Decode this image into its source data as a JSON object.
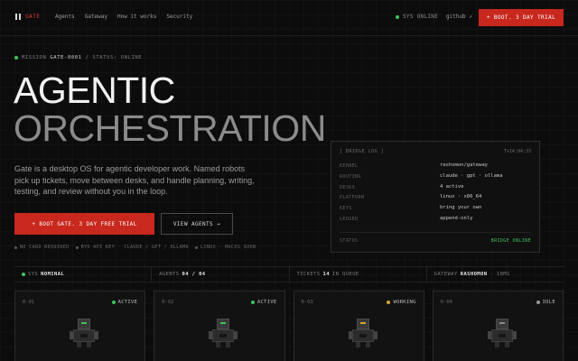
{
  "nav": {
    "brand": "GATE",
    "links": [
      "Agents",
      "Gateway",
      "How it works",
      "Security"
    ],
    "sys_status": "SYS ONLINE",
    "github": "github ↗",
    "cta": "+ BOOT. 3 DAY TRIAL"
  },
  "hero": {
    "mission_prefix": "MISSION",
    "mission_id": "GATE-0001",
    "mission_suffix": "/ STATUS: ONLINE",
    "title_line1": "AGENTIC",
    "title_line2": "ORCHESTRATION",
    "description": "Gate is a desktop OS for agentic developer work. Named robots pick up tickets, move between desks, and handle planning, writing, testing, and review without you in the loop.",
    "cta_primary": "+ BOOT GATE. 3 DAY FREE TRIAL",
    "cta_secondary": "VIEW AGENTS →",
    "features": [
      "NO CARD REQUIRED",
      "BYO API KEY · CLAUDE / GPT / OLLAMA",
      "LINUX · MACOS SOON"
    ]
  },
  "bridge_log": {
    "title": "[ BRIDGE LOG ]",
    "time": "T+14:04:33",
    "rows": [
      {
        "key": "KERNEL",
        "value": "rashomon/gateway"
      },
      {
        "key": "ROUTING",
        "value": "claude · gpt · ollama"
      },
      {
        "key": "DESKS",
        "value": "4 active"
      },
      {
        "key": "PLATFORM",
        "value": "linux · x86_64"
      },
      {
        "key": "KEYS",
        "value": "bring your own"
      },
      {
        "key": "LEDGER",
        "value": "append-only"
      }
    ],
    "status_label": "STATUS",
    "status_value": "BRIDGE ONLINE"
  },
  "status_strip": {
    "sys_label": "SYS",
    "sys_value": "NOMINAL",
    "agents_label": "AGENTS",
    "agents_value": "04 / 04",
    "tickets_label": "TICKETS",
    "tickets_value": "14",
    "tickets_suffix": "IN QUEUE",
    "gateway_label": "GATEWAY",
    "gateway_value": "RASHOMON",
    "gateway_suffix": "· 18MS"
  },
  "robots": [
    {
      "id": "R-01",
      "state": "ACTIVE",
      "state_color": "#3ec45a",
      "eye_color": "#3ec45a"
    },
    {
      "id": "R-02",
      "state": "ACTIVE",
      "state_color": "#3ec45a",
      "eye_color": "#3ec45a"
    },
    {
      "id": "R-03",
      "state": "WORKING",
      "state_color": "#d6a531",
      "eye_color": "#d6a531"
    },
    {
      "id": "R-04",
      "state": "IDLE",
      "state_color": "#9a9a9a",
      "eye_color": "#8a8a8a"
    }
  ],
  "colors": {
    "accent": "#c8281e",
    "online": "#3ec45a",
    "working": "#d6a531"
  }
}
